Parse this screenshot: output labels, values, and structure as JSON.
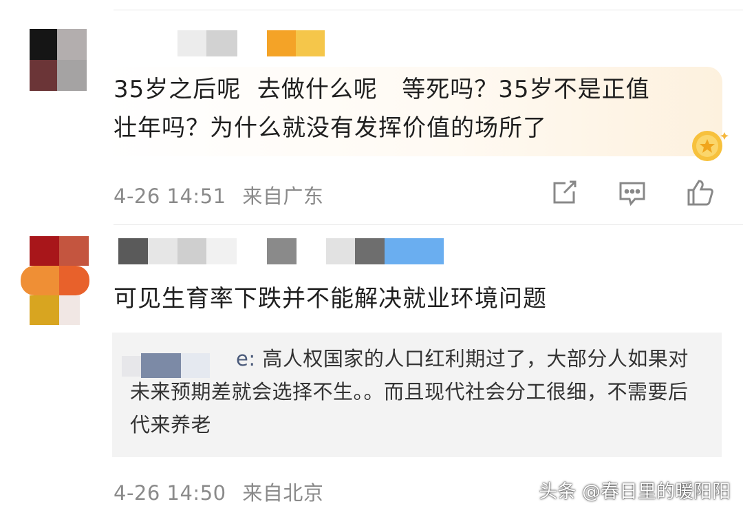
{
  "comments": [
    {
      "text": "35岁之后呢  去做什么呢   等死吗？35岁不是正值\n壮年吗？为什么就没有发挥价值的场所了",
      "date": "4-26 14:51",
      "location": "来自广东",
      "actions": {
        "share_icon": "share-icon",
        "comment_icon": "comment-icon",
        "like_icon": "thumbs-up-icon"
      },
      "accent_color": "#f5a623"
    },
    {
      "text": "可见生育率下跌并不能解决就业环境问题",
      "quote": {
        "author_visible": "e:",
        "text": " 高人权国家的人口红利期过了，大部分人如果对未来预期差就会选择不生。。而且现代社会分工很细，不需要后代来养老"
      },
      "date": "4-26 14:50",
      "location": "来自北京",
      "accent_color": "#6aaef0"
    }
  ],
  "watermark": "头条 @春日里的暖阳阳"
}
